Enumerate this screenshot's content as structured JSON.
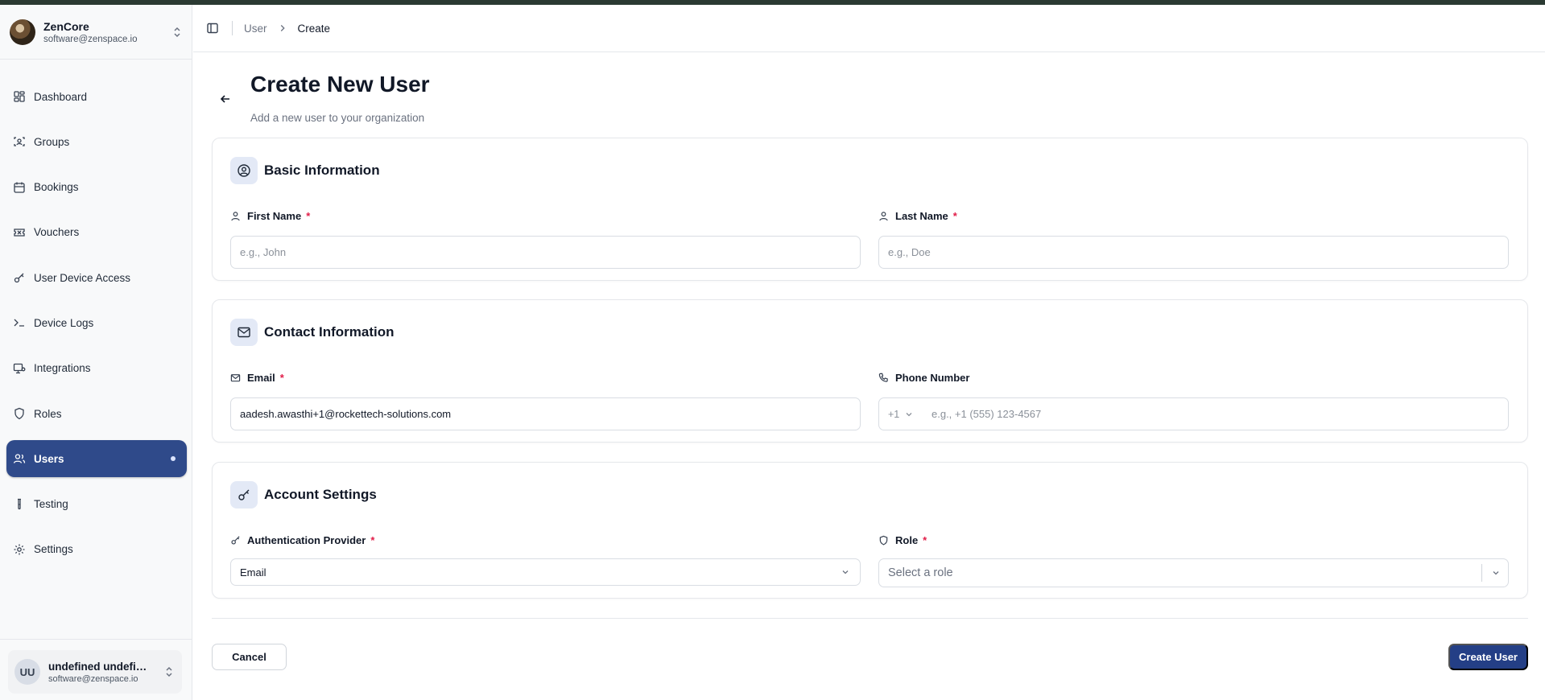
{
  "org": {
    "name": "ZenCore",
    "email": "software@zenspace.io"
  },
  "sidebar": {
    "items": [
      {
        "label": "Dashboard",
        "icon": "dashboard-icon"
      },
      {
        "label": "Groups",
        "icon": "groups-icon"
      },
      {
        "label": "Bookings",
        "icon": "calendar-icon"
      },
      {
        "label": "Vouchers",
        "icon": "ticket-icon"
      },
      {
        "label": "User Device Access",
        "icon": "key-icon"
      },
      {
        "label": "Device Logs",
        "icon": "terminal-icon"
      },
      {
        "label": "Integrations",
        "icon": "monitor-link-icon"
      },
      {
        "label": "Roles",
        "icon": "shield-icon"
      },
      {
        "label": "Users",
        "icon": "users-icon",
        "active": true
      },
      {
        "label": "Testing",
        "icon": "test-tube-icon"
      },
      {
        "label": "Settings",
        "icon": "gear-icon"
      }
    ]
  },
  "user": {
    "initials": "UU",
    "name": "undefined undefin...",
    "email": "software@zenspace.io"
  },
  "breadcrumb": {
    "parent": "User",
    "current": "Create"
  },
  "page": {
    "title": "Create New User",
    "subtitle": "Add a new user to your organization"
  },
  "basic": {
    "title": "Basic Information",
    "first_name": {
      "label": "First Name",
      "required": "*",
      "placeholder": "e.g., John",
      "value": ""
    },
    "last_name": {
      "label": "Last Name",
      "required": "*",
      "placeholder": "e.g., Doe",
      "value": ""
    }
  },
  "contact": {
    "title": "Contact Information",
    "email": {
      "label": "Email",
      "required": "*",
      "value": "aadesh.awasthi+1@rockettech-solutions.com"
    },
    "phone": {
      "label": "Phone Number",
      "country_code": "+1",
      "placeholder": "e.g., +1 (555) 123-4567"
    }
  },
  "account": {
    "title": "Account Settings",
    "auth_provider": {
      "label": "Authentication Provider",
      "required": "*",
      "value": "Email"
    },
    "role": {
      "label": "Role",
      "required": "*",
      "placeholder": "Select a role"
    }
  },
  "actions": {
    "cancel": "Cancel",
    "create": "Create User"
  },
  "colors": {
    "accent": "#2f4a8a",
    "primary_button": "#243f86",
    "required": "#e11d48"
  }
}
